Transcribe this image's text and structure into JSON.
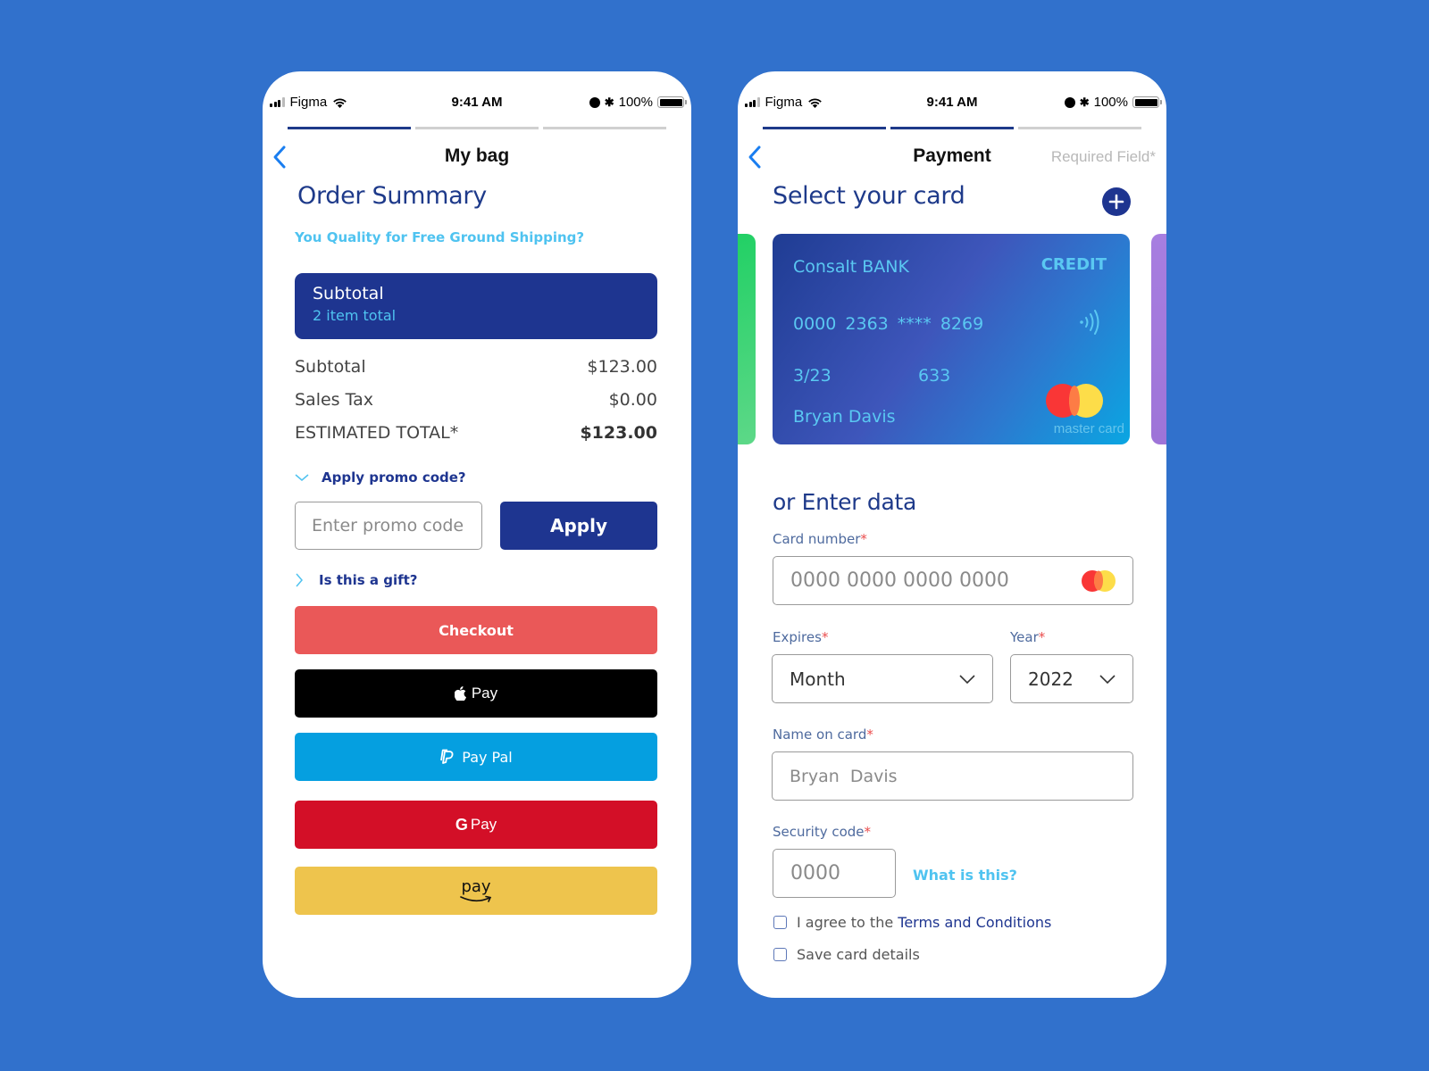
{
  "status_bar": {
    "carrier": "Figma",
    "time": "9:41 AM",
    "battery": "100%"
  },
  "bag_screen": {
    "progress": {
      "steps_total": 3,
      "steps_complete": 1
    },
    "title": "My bag",
    "heading": "Order Summary",
    "shipping_hint": "You Quality for Free Ground Shipping?",
    "subtotal_box": {
      "title": "Subtotal",
      "subtitle": "2 item total"
    },
    "lines": [
      {
        "label": "Subtotal",
        "value": "$123.00"
      },
      {
        "label": "Sales Tax",
        "value": "$0.00"
      },
      {
        "label": "ESTIMATED TOTAL*",
        "value": "$123.00"
      }
    ],
    "promo_toggle": "Apply promo code?",
    "promo_placeholder": "Enter promo code",
    "apply_label": "Apply",
    "gift_toggle": "Is this a gift?",
    "buttons": {
      "checkout": "Checkout",
      "apple_pay": "Pay",
      "paypal": "Pay Pal",
      "gpay_g": "G",
      "gpay": "Pay",
      "amazon_pay": "pay"
    },
    "colors": {
      "brand": "#1e3590",
      "accent": "#4fc3f0",
      "checkout": "#ea5858",
      "apple": "#000000",
      "paypal": "#059fe0",
      "gpay": "#d30f27",
      "amazon": "#eec44d"
    }
  },
  "payment_screen": {
    "progress": {
      "steps_total": 3,
      "steps_complete": 2
    },
    "title": "Payment",
    "required_note": "Required Field*",
    "heading": "Select your card",
    "card": {
      "bank": "Consalt BANK",
      "type": "CREDIT",
      "number": "0000  2363  ****  8269",
      "expiry": "3/23",
      "cvv": "633",
      "holder": "Bryan  Davis",
      "network": "master card"
    },
    "form_heading": "or Enter data",
    "card_number": {
      "label": "Card number",
      "required": "*",
      "placeholder": "0000 0000 0000 0000"
    },
    "expires": {
      "label": "Expires",
      "required": "*",
      "value": "Month"
    },
    "year": {
      "label": "Year",
      "required": "*",
      "value": "2022"
    },
    "name": {
      "label": "Name on card",
      "required": "*",
      "placeholder": "Bryan  Davis"
    },
    "security": {
      "label": "Security code",
      "required": "*",
      "placeholder": "0000"
    },
    "what_is_this": "What is this?",
    "agree_prefix": "I agree to the",
    "agree_link": "Terms and Conditions",
    "agree_checked": false,
    "save_card": "Save card details",
    "save_checked": false
  }
}
